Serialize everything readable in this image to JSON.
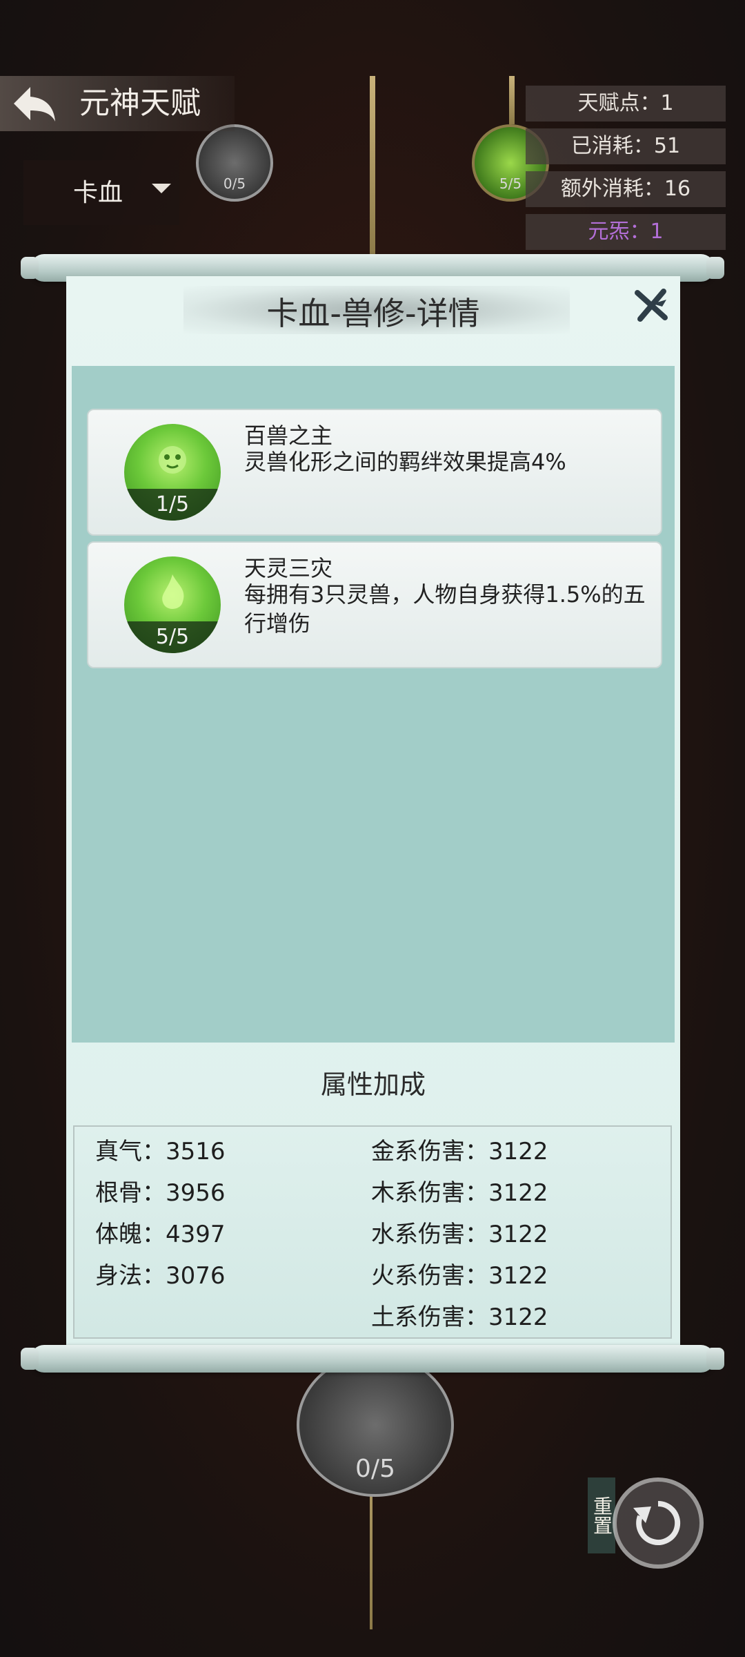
{
  "header": {
    "title": "元神天赋"
  },
  "class_select": {
    "value": "卡血"
  },
  "stats": [
    {
      "label": "天赋点：1"
    },
    {
      "label": "已消耗：51"
    },
    {
      "label": "额外消耗：16"
    },
    {
      "label": "元炁：1"
    }
  ],
  "tree_nodes": {
    "top_left_count": "0/5",
    "top_right_count": "5/5",
    "bottom_count": "0/5"
  },
  "reset": {
    "label": "重置"
  },
  "dialog": {
    "title": "卡血-兽修-详情",
    "talents": [
      {
        "name": "百兽之主",
        "desc": "灵兽化形之间的羁绊效果提高4%",
        "level": "1/5"
      },
      {
        "name": "天灵三灾",
        "desc": "每拥有3只灵兽，人物自身获得1.5%的五行增伤",
        "level": "5/5"
      }
    ],
    "bonus_title": "属性加成",
    "bonus_left": [
      {
        "text": "真气：3516"
      },
      {
        "text": "根骨：3956"
      },
      {
        "text": "体魄：4397"
      },
      {
        "text": "身法：3076"
      }
    ],
    "bonus_right": [
      {
        "text": "金系伤害：3122"
      },
      {
        "text": "木系伤害：3122"
      },
      {
        "text": "水系伤害：3122"
      },
      {
        "text": "火系伤害：3122"
      },
      {
        "text": "土系伤害：3122"
      }
    ]
  },
  "colors": {
    "accent_purple": "#b36fd8",
    "panel_teal": "#a2cdc8",
    "talent_green": "#6cc93a"
  },
  "icons": [
    "back-arrow-icon",
    "caret-down-icon",
    "close-icon",
    "reset-icon",
    "beast-icon",
    "spirit-flame-icon"
  ]
}
